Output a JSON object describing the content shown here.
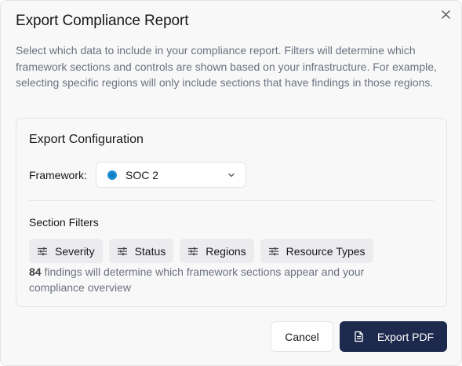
{
  "dialog": {
    "title": "Export Compliance Report",
    "description": "Select which data to include in your compliance report. Filters will determine which framework sections and controls are shown based on your infrastructure. For example, selecting specific regions will only include sections that have findings in those regions.",
    "close_icon": "close-icon"
  },
  "config": {
    "title": "Export Configuration",
    "framework_label": "Framework:",
    "framework_value": "SOC 2",
    "framework_icon": "soc2-logo-icon",
    "framework_icon_color": "#1d8fd6",
    "section_filters_title": "Section Filters",
    "filters": [
      {
        "label": "Severity",
        "icon": "sliders-icon"
      },
      {
        "label": "Status",
        "icon": "sliders-icon"
      },
      {
        "label": "Regions",
        "icon": "sliders-icon"
      },
      {
        "label": "Resource Types",
        "icon": "sliders-icon"
      }
    ],
    "findings_count": "84",
    "findings_text": " findings will determine which framework sections appear and your compliance overview"
  },
  "actions": {
    "cancel_label": "Cancel",
    "export_label": "Export PDF",
    "export_icon": "document-icon",
    "export_bg": "#1e2a4d"
  }
}
